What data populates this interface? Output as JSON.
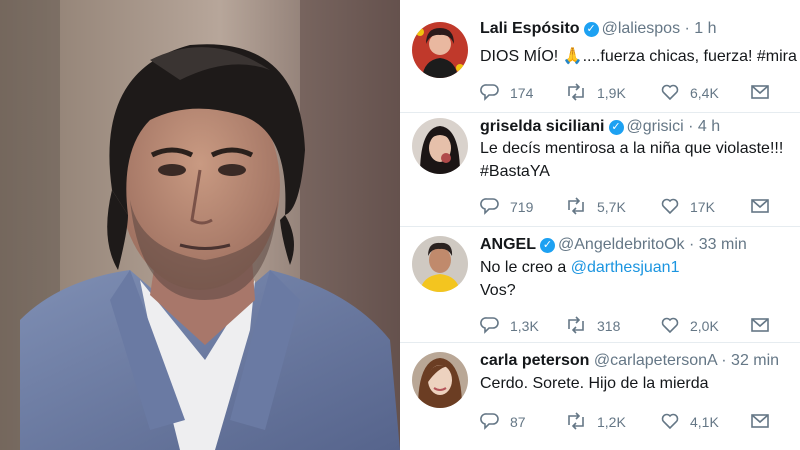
{
  "tweets": [
    {
      "name": "Lali Espósito",
      "verified": true,
      "handle": "@laliespos",
      "time": "· 1 h",
      "text_lines": [
        {
          "before": "DIOS MÍO! ",
          "emoji": "🙏",
          "after": "....fuerza chicas, fuerza! #mira"
        }
      ],
      "replies": "174",
      "retweets": "1,9K",
      "likes": "6,4K"
    },
    {
      "name": "griselda siciliani",
      "verified": true,
      "handle": "@grisici",
      "time": "· 4 h",
      "text_lines": [
        {
          "before": "Le decís mentirosa  a la niña que violaste!!!"
        },
        {
          "before": "#BastaYA"
        }
      ],
      "replies": "719",
      "retweets": "5,7K",
      "likes": "17K"
    },
    {
      "name": "ANGEL",
      "verified": true,
      "handle": "@AngeldebritoOk",
      "time": "· 33 min",
      "text_lines": [
        {
          "before": "No le creo a ",
          "mention": "@darthesjuan1"
        },
        {
          "before": "Vos?"
        }
      ],
      "replies": "1,3K",
      "retweets": "318",
      "likes": "2,0K"
    },
    {
      "name": "carla peterson",
      "verified": false,
      "handle": "@carlapetersonA",
      "time": "· 32 min",
      "text_lines": [
        {
          "before": "Cerdo. Sorete. Hijo de la mierda"
        }
      ],
      "replies": "87",
      "retweets": "1,2K",
      "likes": "4,1K"
    }
  ],
  "icons": {
    "reply": "reply-icon",
    "retweet": "retweet-icon",
    "like": "heart-icon",
    "dm": "envelope-icon",
    "verified": "verified-badge-icon"
  },
  "verified_mark": "✓",
  "colors": {
    "verified": "#1da1f2",
    "mention": "#1b95e0",
    "secondary_text": "#657786",
    "primary_text": "#14171a",
    "divider": "#e6ecf0"
  }
}
